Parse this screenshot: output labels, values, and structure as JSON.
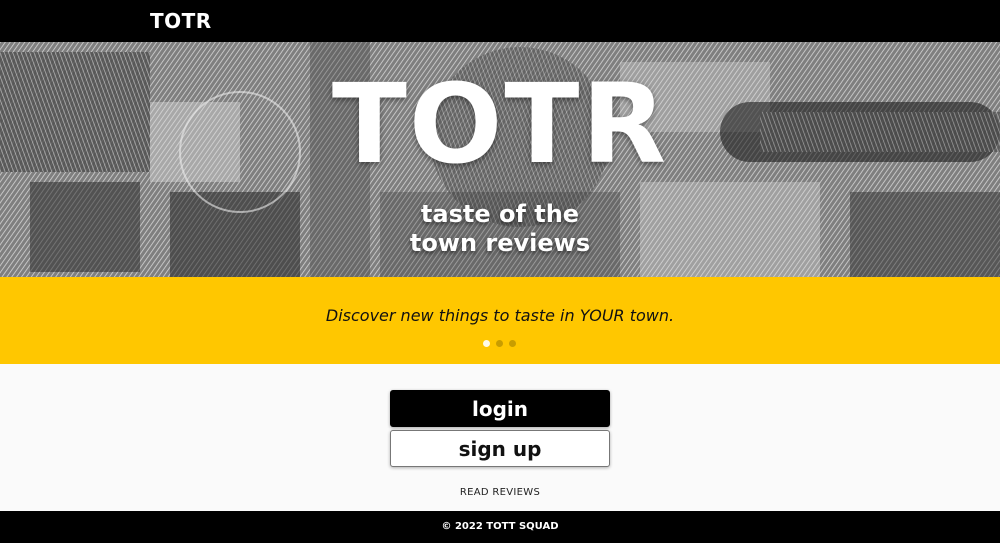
{
  "nav": {
    "brand": "TOTR"
  },
  "hero": {
    "title": "TOTR",
    "subtitle_line1": "taste of the",
    "subtitle_line2": "town reviews"
  },
  "banner": {
    "tagline": "Discover new things to taste in YOUR town.",
    "slides_total": 3,
    "active_slide": 1
  },
  "actions": {
    "login_label": "login",
    "signup_label": "sign up",
    "read_reviews_label": "READ REVIEWS"
  },
  "footer": {
    "copyright": "© 2022 TOTT SQUAD"
  },
  "colors": {
    "accent_yellow": "#ffc700",
    "black": "#000000",
    "white": "#ffffff"
  }
}
